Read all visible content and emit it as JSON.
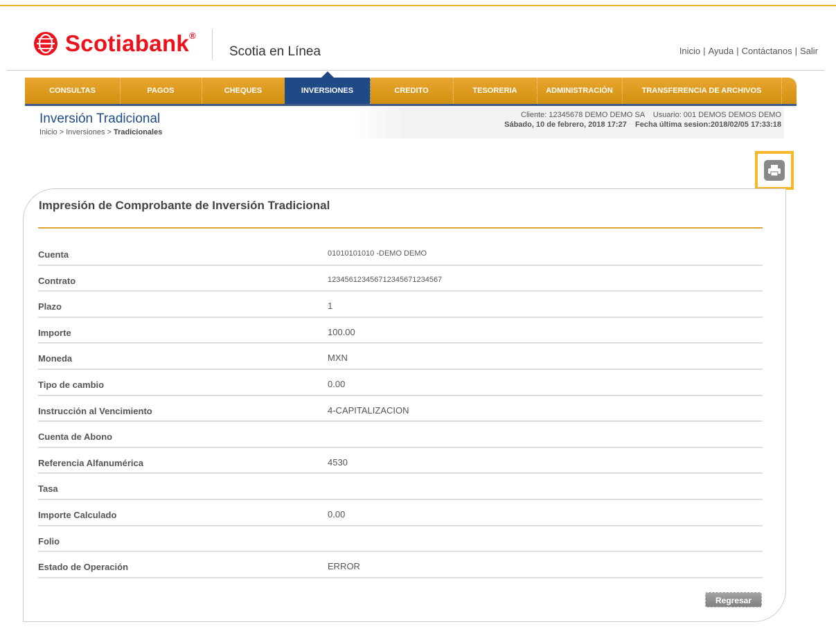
{
  "brand": {
    "name": "Scotiabank",
    "registered": "®",
    "subtitle": "Scotia en Línea",
    "color": "#ec111a"
  },
  "top_links": [
    "Inicio",
    "Ayuda",
    "Contáctanos",
    "Salir"
  ],
  "nav": {
    "items": [
      "CONSULTAS",
      "PAGOS",
      "CHEQUES",
      "INVERSIONES",
      "CREDITO",
      "TESORERIA",
      "ADMINISTRACIÓN",
      "TRANSFERENCIA DE ARCHIVOS"
    ],
    "active": "INVERSIONES",
    "colors": {
      "bar": "#d99a1c",
      "active": "#204a86"
    }
  },
  "page": {
    "title": "Inversión Tradicional",
    "breadcrumb": {
      "prefix": "Inicio > Inversiones > ",
      "current": "Tradicionales"
    }
  },
  "session_info": {
    "line1": "Cliente: 12345678 DEMO DEMO SA    Usuario: 001 DEMOS DEMOS DEMO",
    "line2": "Sábado, 10 de febrero, 2018 17:27    Fecha última sesion:2018/02/05 17:33:18"
  },
  "print_icon": "printer-icon",
  "content": {
    "title": "Impresión de Comprobante de Inversión Tradicional",
    "rows": [
      {
        "label": "Cuenta",
        "value": "01010101010 -DEMO DEMO"
      },
      {
        "label": "Contrato",
        "value": "1234561234567123456712345​67"
      },
      {
        "label": "Plazo",
        "value": "1"
      },
      {
        "label": "Importe",
        "value": "100.00"
      },
      {
        "label": "Moneda",
        "value": "MXN"
      },
      {
        "label": "Tipo de cambio",
        "value": "0.00"
      },
      {
        "label": "Instrucción al Vencimiento",
        "value": "4-CAPITALIZACION"
      },
      {
        "label": "Cuenta de Abono",
        "value": ""
      },
      {
        "label": "Referencia Alfanumérica",
        "value": "4530"
      },
      {
        "label": "Tasa",
        "value": ""
      },
      {
        "label": "Importe Calculado",
        "value": "0.00"
      },
      {
        "label": "Folio",
        "value": ""
      },
      {
        "label": "Estado de Operación",
        "value": "ERROR"
      }
    ],
    "back_button": "Regresar"
  }
}
